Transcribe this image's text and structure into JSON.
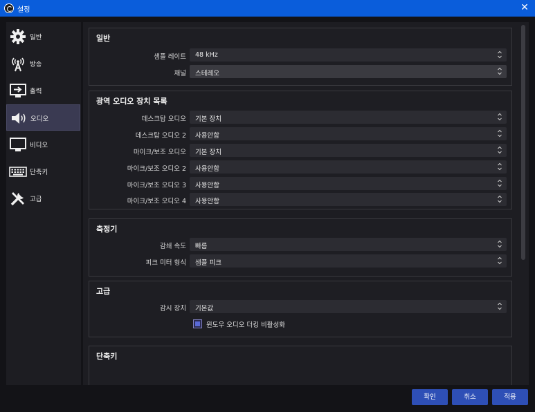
{
  "window": {
    "title": "설정"
  },
  "sidebar": {
    "items": [
      {
        "label": "일반",
        "icon": "gear-icon"
      },
      {
        "label": "방송",
        "icon": "broadcast-icon"
      },
      {
        "label": "출력",
        "icon": "output-icon"
      },
      {
        "label": "오디오",
        "icon": "speaker-icon",
        "active": true
      },
      {
        "label": "비디오",
        "icon": "monitor-icon"
      },
      {
        "label": "단축키",
        "icon": "keyboard-icon"
      },
      {
        "label": "고급",
        "icon": "tools-icon"
      }
    ]
  },
  "general": {
    "title": "일반",
    "sample_rate_label": "샘플 레이트",
    "sample_rate_value": "48 kHz",
    "channels_label": "채널",
    "channels_value": "스테레오"
  },
  "global_audio": {
    "title": "광역 오디오 장치 목록",
    "rows": [
      {
        "label": "데스크탑 오디오",
        "value": "기본 장치"
      },
      {
        "label": "데스크탑 오디오 2",
        "value": "사용안함"
      },
      {
        "label": "마이크/보조 오디오",
        "value": "기본 장치"
      },
      {
        "label": "마이크/보조 오디오 2",
        "value": "사용안함"
      },
      {
        "label": "마이크/보조 오디오 3",
        "value": "사용안함"
      },
      {
        "label": "마이크/보조 오디오 4",
        "value": "사용안함"
      }
    ]
  },
  "meters": {
    "title": "측정기",
    "decay_label": "감쇄 속도",
    "decay_value": "빠름",
    "peak_label": "피크 미터 형식",
    "peak_value": "샘플 피크"
  },
  "advanced": {
    "title": "고급",
    "monitor_label": "감시 장치",
    "monitor_value": "기본값",
    "ducking_label": "윈도우 오디오 더킹 비활성화"
  },
  "hotkeys": {
    "title": "단축키"
  },
  "buttons": {
    "ok": "확인",
    "cancel": "취소",
    "apply": "적용"
  },
  "colors": {
    "titlebar": "#0a5ddb",
    "button": "#2e4fb6",
    "active_nav": "#3a3a52"
  }
}
